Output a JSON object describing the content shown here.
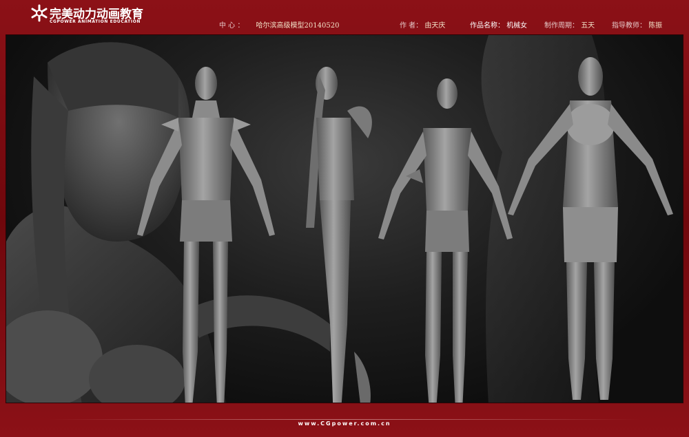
{
  "brand": {
    "logo_cn": "完美动力动画教育",
    "logo_en": "CGPOWER ANIMATION EDUCATION"
  },
  "info": {
    "center_label": "中 心 ：",
    "center_value": "哈尔滨高级模型20140520",
    "author_label": "作 者：",
    "author_value": "由天庆",
    "work_label": "作品名称：",
    "work_value": "机械女",
    "period_label": "制作周期：",
    "period_value": "五天",
    "teacher_label": "指导教师：",
    "teacher_value": "陈振"
  },
  "footer": {
    "website": "www.CGpower.com.cn"
  },
  "colors": {
    "frame": "#7a0b10",
    "viewport": "#1e1e1e",
    "sculpt": "#8a8a8a"
  },
  "artwork": {
    "views": [
      "face-closeup",
      "front-view",
      "side-view",
      "three-quarter-view",
      "back-view"
    ]
  }
}
